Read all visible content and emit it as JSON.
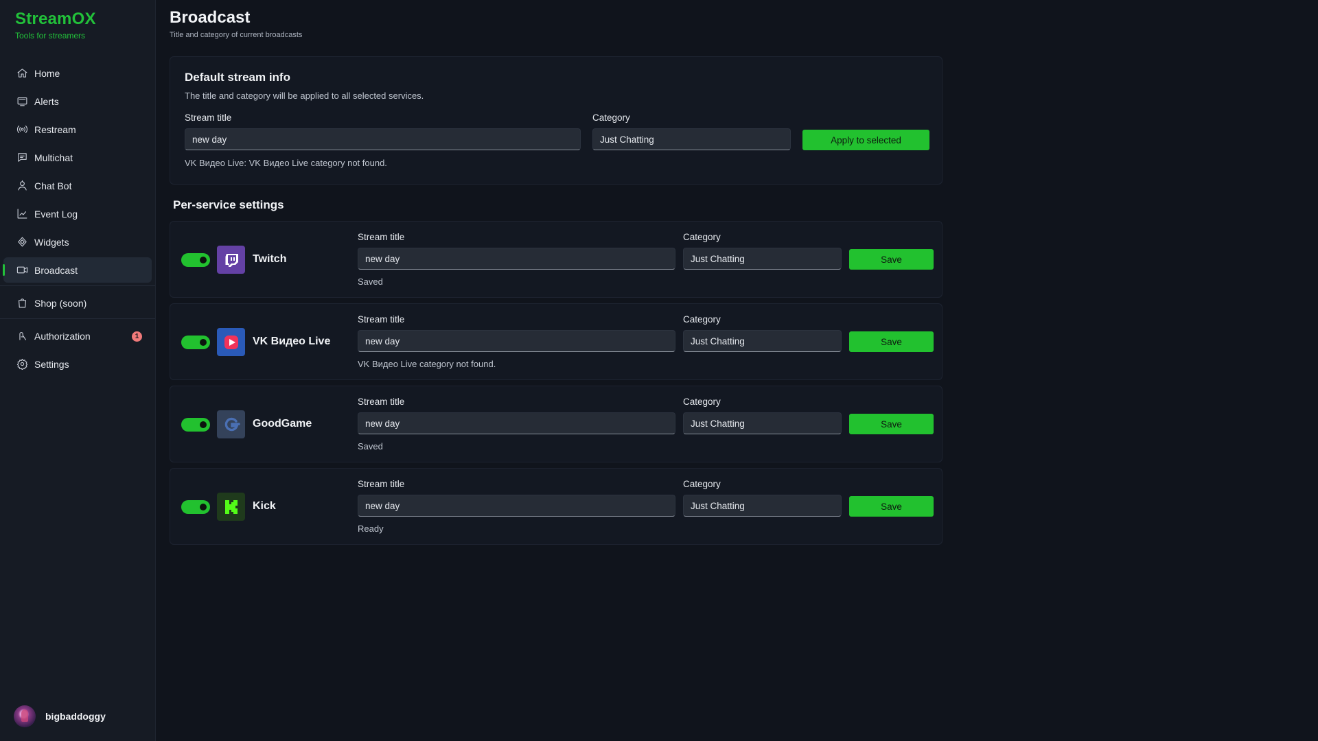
{
  "brand": {
    "name": "StreamOX",
    "tagline": "Tools for streamers"
  },
  "sidebar": {
    "items": [
      {
        "label": "Home",
        "icon": "home-icon"
      },
      {
        "label": "Alerts",
        "icon": "alerts-icon"
      },
      {
        "label": "Restream",
        "icon": "broadcast-waves-icon"
      },
      {
        "label": "Multichat",
        "icon": "chat-icon"
      },
      {
        "label": "Chat Bot",
        "icon": "bot-icon"
      },
      {
        "label": "Event Log",
        "icon": "chart-icon"
      },
      {
        "label": "Widgets",
        "icon": "widgets-icon"
      },
      {
        "label": "Broadcast",
        "icon": "camera-icon",
        "active": true
      },
      {
        "label": "Shop (soon)",
        "icon": "shopping-bag-icon"
      },
      {
        "label": "Authorization",
        "icon": "key-icon",
        "badge": "1"
      },
      {
        "label": "Settings",
        "icon": "gear-icon"
      }
    ],
    "user": {
      "name": "bigbaddoggy"
    }
  },
  "header": {
    "title": "Broadcast",
    "subtitle": "Title and category of current broadcasts"
  },
  "default_info": {
    "title": "Default stream info",
    "description": "The title and category will be applied to all selected services.",
    "stream_title_label": "Stream title",
    "stream_title_value": "new day",
    "category_label": "Category",
    "category_value": "Just Chatting",
    "apply_label": "Apply to selected",
    "note": "VK Видео Live: VK Видео Live category not found."
  },
  "per_service": {
    "title": "Per-service settings",
    "services": [
      {
        "name": "Twitch",
        "enabled": true,
        "title_label": "Stream title",
        "title_value": "new day",
        "category_label": "Category",
        "category_value": "Just Chatting",
        "save_label": "Save",
        "status": "Saved",
        "logo_color": "#6441a5"
      },
      {
        "name": "VK Видео Live",
        "enabled": true,
        "title_label": "Stream title",
        "title_value": "new day",
        "category_label": "Category",
        "category_value": "Just Chatting",
        "save_label": "Save",
        "status": "VK Видео Live category not found.",
        "logo_color": "#2a5ab8"
      },
      {
        "name": "GoodGame",
        "enabled": true,
        "title_label": "Stream title",
        "title_value": "new day",
        "category_label": "Category",
        "category_value": "Just Chatting",
        "save_label": "Save",
        "status": "Saved",
        "logo_color": "#34425a"
      },
      {
        "name": "Kick",
        "enabled": true,
        "title_label": "Stream title",
        "title_value": "new day",
        "category_label": "Category",
        "category_value": "Just Chatting",
        "save_label": "Save",
        "status": "Ready",
        "logo_color": "#53fc18"
      }
    ]
  },
  "colors": {
    "accent": "#22c13a",
    "button": "#22c12f",
    "badge": "#f07a7a"
  }
}
